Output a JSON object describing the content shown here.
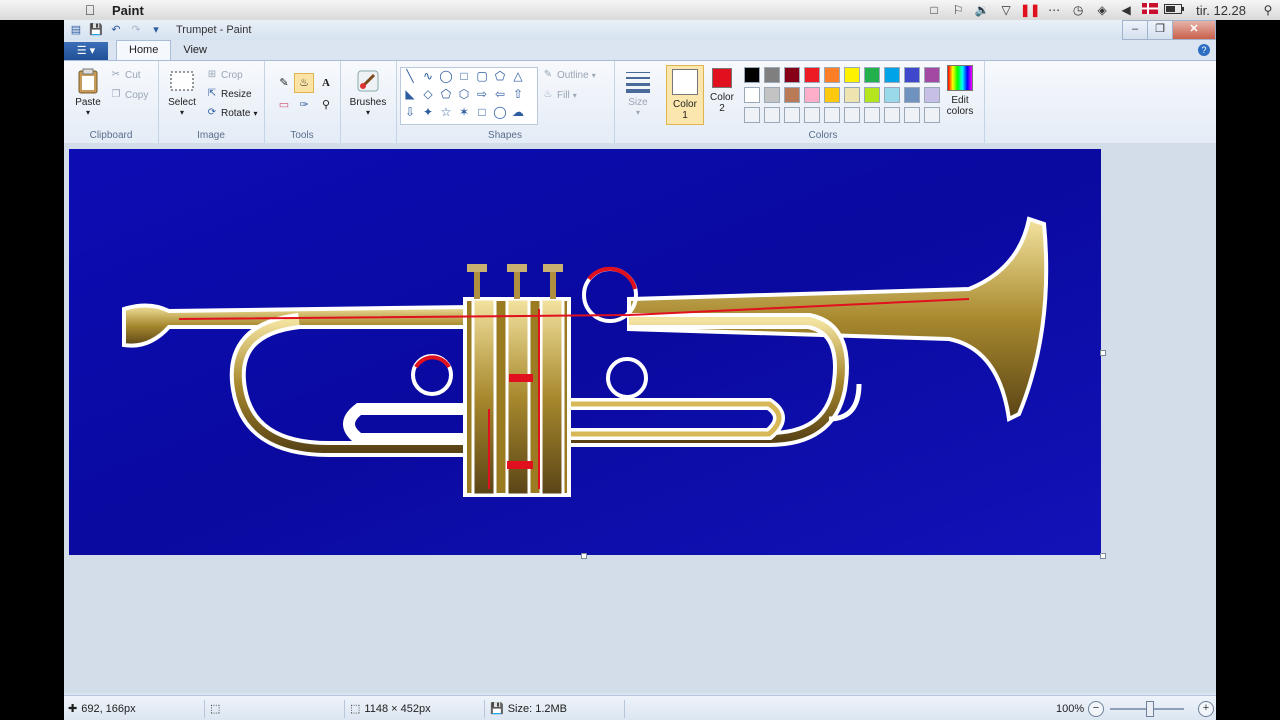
{
  "mac_menubar": {
    "app_name": "Paint",
    "clock": "tir. 12.28",
    "status_icons": [
      "camera-icon",
      "flag-icon",
      "volume-icon",
      "triangle-icon",
      "pause-icon",
      "dots-icon",
      "history-icon",
      "wifi-icon",
      "speaker-icon",
      "dk-flag-icon",
      "battery-icon",
      "search-icon"
    ]
  },
  "window": {
    "title": "Trumpet - Paint"
  },
  "tabs": {
    "file": "☰ ▾",
    "home": "Home",
    "view": "View"
  },
  "ribbon": {
    "clipboard": {
      "paste": "Paste",
      "cut": "Cut",
      "copy": "Copy",
      "label": "Clipboard"
    },
    "image": {
      "select": "Select",
      "crop": "Crop",
      "resize": "Resize",
      "rotate": "Rotate",
      "label": "Image"
    },
    "tools": {
      "label": "Tools"
    },
    "brushes": {
      "label": "Brushes"
    },
    "shapes": {
      "outline": "Outline",
      "fill": "Fill",
      "label": "Shapes"
    },
    "size": {
      "label": "Size"
    },
    "colors": {
      "color1": "Color\n1",
      "color1_a": "Color",
      "color1_b": "1",
      "color2_a": "Color",
      "color2_b": "2",
      "edit_a": "Edit",
      "edit_b": "colors",
      "label": "Colors",
      "color1_value": "#ffffff",
      "color2_value": "#e0101e",
      "palette_row1": [
        "#000000",
        "#7f7f7f",
        "#880015",
        "#ed1c24",
        "#ff7f27",
        "#fff200",
        "#22b14c",
        "#00a2e8",
        "#3f48cc",
        "#a349a4"
      ],
      "palette_row2": [
        "#ffffff",
        "#c3c3c3",
        "#b97a57",
        "#ffaec9",
        "#ffc90e",
        "#efe4b0",
        "#b5e61d",
        "#99d9ea",
        "#7092be",
        "#c8bfe7"
      ]
    }
  },
  "canvas": {
    "background": "#0a0aa8"
  },
  "statusbar": {
    "cursor": "692, 166px",
    "dimensions": "1148 × 452px",
    "size": "Size: 1.2MB",
    "zoom": "100%"
  }
}
